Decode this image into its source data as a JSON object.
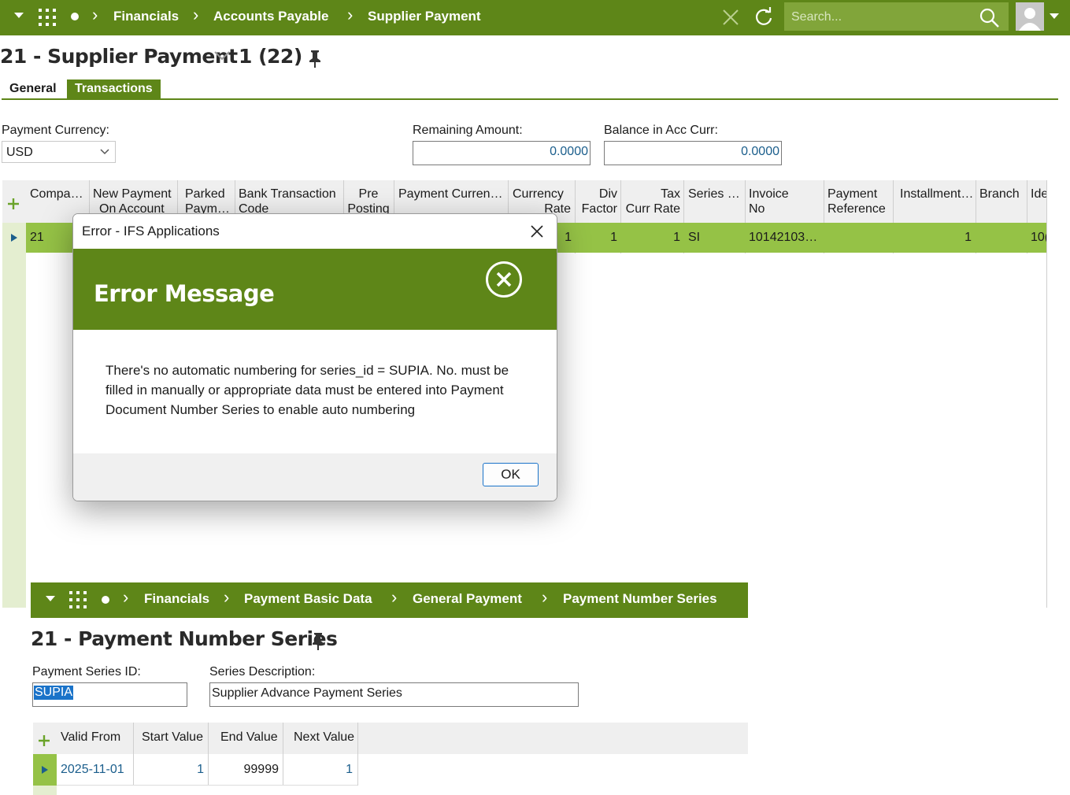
{
  "nav": {
    "crumbs": [
      "Financials",
      "Accounts Payable",
      "Supplier Payment"
    ],
    "search_placeholder": "Search..."
  },
  "page": {
    "title": "21 - Supplier Payment",
    "record": "1 (22)",
    "tabs": [
      "General",
      "Transactions"
    ]
  },
  "form": {
    "payment_currency_label": "Payment Currency:",
    "payment_currency_value": "USD",
    "remaining_amount_label": "Remaining Amount:",
    "remaining_amount_value": "0.0000",
    "balance_label": "Balance in Acc Curr:",
    "balance_value": "0.0000"
  },
  "grid": {
    "columns": [
      [
        "Compa…",
        ""
      ],
      [
        "New Payment",
        "On Account"
      ],
      [
        "Parked",
        "Paym…"
      ],
      [
        "Bank Transaction",
        "Code"
      ],
      [
        "Pre",
        "Posting"
      ],
      [
        "Payment Curren…",
        ""
      ],
      [
        "Currency",
        "Rate"
      ],
      [
        "Div",
        "Factor"
      ],
      [
        "Tax",
        "Curr Rate"
      ],
      [
        "Series …",
        ""
      ],
      [
        "Invoice",
        "No"
      ],
      [
        "Payment",
        "Reference"
      ],
      [
        "Installment…",
        ""
      ],
      [
        "Branch",
        ""
      ],
      [
        "Ide",
        ""
      ]
    ],
    "row": {
      "company": "21",
      "currency_rate": "1",
      "div_factor": "1",
      "tax_curr_rate": "1",
      "series": "SI",
      "invoice_no": "10142103…",
      "installment": "1",
      "ident": "10("
    }
  },
  "dialog": {
    "window_title": "Error - IFS Applications",
    "heading": "Error Message",
    "message_lines": [
      "There's no automatic numbering for series_id = SUPIA. No. must be",
      "filled in manually or appropriate data must be entered into Payment",
      "Document Number Series to enable auto numbering"
    ],
    "ok_label": "OK"
  },
  "nav2": {
    "crumbs": [
      "Financials",
      "Payment Basic Data",
      "General Payment",
      "Payment Number Series"
    ]
  },
  "series_page": {
    "title": "21 - Payment Number Series",
    "series_id_label": "Payment Series ID:",
    "series_id_value": "SUPIA",
    "description_label": "Series Description:",
    "description_value": "Supplier Advance Payment Series",
    "columns": [
      "Valid From",
      "Start Value",
      "End Value",
      "Next Value"
    ],
    "row": {
      "valid_from": "2025-11-01",
      "start": "1",
      "end": "99999",
      "next": "1"
    }
  },
  "colors": {
    "accent": "#5e8618",
    "row_highlight": "#95c246",
    "row_gutter": "#e4eed0"
  }
}
